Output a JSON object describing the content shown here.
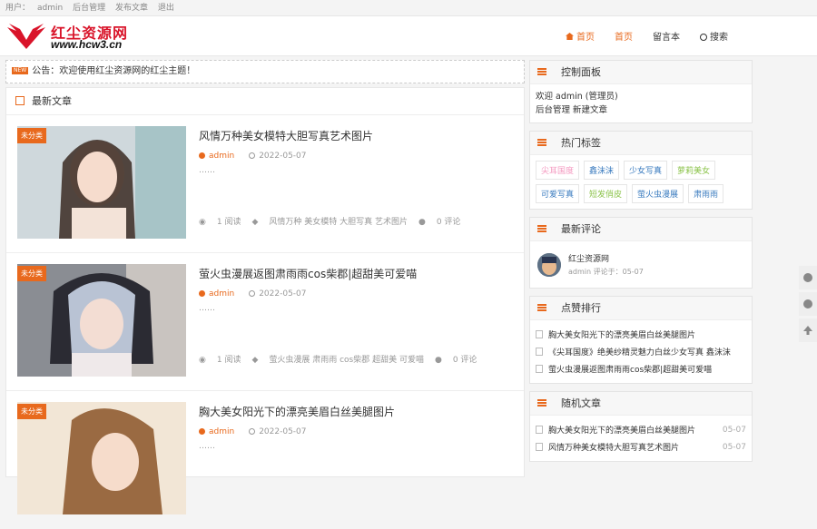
{
  "topbar": {
    "user_label": "用户：",
    "user": "admin",
    "admin_link": "后台管理",
    "publish_link": "发布文章",
    "logout": "退出"
  },
  "logo": {
    "cn": "红尘资源网",
    "url": "www.hcw3.cn"
  },
  "nav": {
    "items": [
      "首页",
      "首页",
      "留言本",
      "搜索"
    ]
  },
  "notice": {
    "badge": "NEW",
    "text": "公告：欢迎使用红尘资源网的红尘主题！"
  },
  "main": {
    "heading": "最新文章",
    "articles": [
      {
        "badge": "未分类",
        "title": "风情万种美女模特大胆写真艺术图片",
        "author": "admin",
        "date": "2022-05-07",
        "desc": "……",
        "reads": "1 阅读",
        "tags": "风情万种 美女模特 大胆写真 艺术图片",
        "comments": "0 评论"
      },
      {
        "badge": "未分类",
        "title": "萤火虫漫展返图肃雨雨cos柴郡|超甜美可爱喵",
        "author": "admin",
        "date": "2022-05-07",
        "desc": "……",
        "reads": "1 阅读",
        "tags": "萤火虫漫展 肃雨雨 cos柴郡 超甜美 可爱喵",
        "comments": "0 评论"
      },
      {
        "badge": "未分类",
        "title": "胸大美女阳光下的漂亮美眉白丝美腿图片",
        "author": "admin",
        "date": "2022-05-07",
        "desc": "……",
        "reads": "",
        "tags": "",
        "comments": ""
      }
    ]
  },
  "sidebar": {
    "panel": {
      "title": "控制面板",
      "welcome": "欢迎 admin (管理员)",
      "link1": "后台管理",
      "link2": "新建文章"
    },
    "tags": {
      "title": "热门标签",
      "items": [
        {
          "label": "尖耳国度",
          "color": "#f49ac0"
        },
        {
          "label": "鑫沫沫",
          "color": "#3a7bbf"
        },
        {
          "label": "少女写真",
          "color": "#3a7bbf"
        },
        {
          "label": "萝莉美女",
          "color": "#8bc34a"
        },
        {
          "label": "可爱写真",
          "color": "#3a7bbf"
        },
        {
          "label": "短发俏皮",
          "color": "#8bc34a"
        },
        {
          "label": "萤火虫漫展",
          "color": "#3a7bbf"
        },
        {
          "label": "肃雨雨",
          "color": "#3a7bbf"
        }
      ]
    },
    "comments": {
      "title": "最新评论",
      "name": "红尘资源网",
      "sub": "admin  评论于：05-07"
    },
    "ranking": {
      "title": "点赞排行",
      "items": [
        "胸大美女阳光下的漂亮美眉白丝美腿图片",
        "《尖耳国度》绝美纱精灵魅力白丝少女写真 鑫沫沫",
        "萤火虫漫展返图肃雨雨cos柴郡|超甜美可爱喵"
      ]
    },
    "random": {
      "title": "随机文章",
      "items": [
        {
          "title": "胸大美女阳光下的漂亮美眉白丝美腿图片",
          "date": "05-07"
        },
        {
          "title": "风情万种美女模特大胆写真艺术图片",
          "date": "05-07"
        }
      ]
    }
  },
  "colors": {
    "accent": "#e8691d"
  }
}
